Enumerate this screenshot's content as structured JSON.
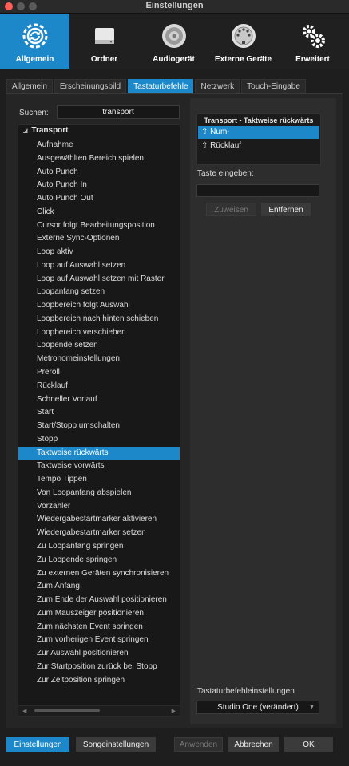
{
  "window": {
    "title": "Einstellungen"
  },
  "categories": [
    {
      "label": "Allgemein",
      "icon": "gear-sync-icon",
      "active": true
    },
    {
      "label": "Ordner",
      "icon": "drive-icon",
      "active": false
    },
    {
      "label": "Audiogerät",
      "icon": "speaker-icon",
      "active": false
    },
    {
      "label": "Externe Geräte",
      "icon": "midi-port-icon",
      "active": false
    },
    {
      "label": "Erweitert",
      "icon": "gears-icon",
      "active": false
    }
  ],
  "tabs": [
    "Allgemein",
    "Erscheinungsbild",
    "Tastaturbefehle",
    "Netzwerk",
    "Touch-Eingabe"
  ],
  "active_tab": "Tastaturbefehle",
  "search": {
    "label": "Suchen:",
    "value": "transport"
  },
  "tree": {
    "group": "Transport",
    "items": [
      "Aufnahme",
      "Ausgewählten Bereich spielen",
      "Auto Punch",
      "Auto Punch In",
      "Auto Punch Out",
      "Click",
      "Cursor folgt Bearbeitungsposition",
      "Externe Sync-Optionen",
      "Loop aktiv",
      "Loop auf Auswahl setzen",
      "Loop auf Auswahl setzen mit Raster",
      "Loopanfang setzen",
      "Loopbereich folgt Auswahl",
      "Loopbereich nach hinten schieben",
      "Loopbereich verschieben",
      "Loopende setzen",
      "Metronomeinstellungen",
      "Preroll",
      "Rücklauf",
      "Schneller Vorlauf",
      "Start",
      "Start/Stopp umschalten",
      "Stopp",
      "Taktweise rückwärts",
      "Taktweise vorwärts",
      "Tempo Tippen",
      "Von Loopanfang abspielen",
      "Vorzähler",
      "Wiedergabestartmarker aktivieren",
      "Wiedergabestartmarker setzen",
      "Zu Loopanfang springen",
      "Zu Loopende springen",
      "Zu externen Geräten synchronisieren",
      "Zum Anfang",
      "Zum Ende der Auswahl positionieren",
      "Zum Mauszeiger positionieren",
      "Zum nächsten Event springen",
      "Zum vorherigen Event springen",
      "Zur Auswahl positionieren",
      "Zur Startposition zurück bei Stopp",
      "Zur Zeitposition springen"
    ],
    "selected": "Taktweise rückwärts"
  },
  "command": {
    "title": "Transport - Taktweise rückwärts",
    "shortcuts": [
      "⇧ Num-",
      "⇧ Rücklauf"
    ]
  },
  "key_entry": {
    "label": "Taste eingeben:",
    "value": ""
  },
  "buttons": {
    "assign": "Zuweisen",
    "remove": "Entfernen"
  },
  "keymap": {
    "label": "Tastaturbefehleinstellungen",
    "value": "Studio One (verändert)"
  },
  "footer": {
    "settings": "Einstellungen",
    "song_settings": "Songeinstellungen",
    "apply": "Anwenden",
    "cancel": "Abbrechen",
    "ok": "OK"
  },
  "colors": {
    "accent": "#1d88c9",
    "background": "#1e1e1e"
  }
}
